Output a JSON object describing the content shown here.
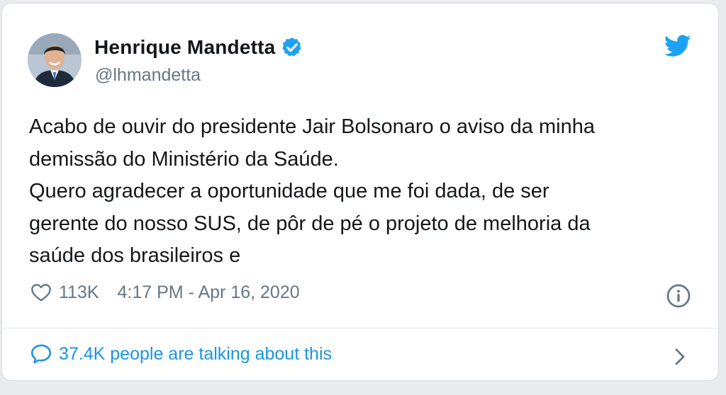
{
  "tweet": {
    "author": {
      "name": "Henrique Mandetta",
      "handle": "@lhmandetta",
      "verified": true
    },
    "text_lines": [
      "Acabo de ouvir do presidente Jair Bolsonaro o aviso da minha",
      "demissão do Ministério da Saúde.",
      "Quero agradecer a oportunidade que me foi dada, de ser",
      "gerente do nosso SUS, de pôr de pé o projeto de melhoria da",
      "saúde dos brasileiros e"
    ],
    "likes": "113K",
    "timestamp": "4:17 PM - Apr 16, 2020",
    "footer_text": "37.4K people are talking about this"
  },
  "icons": {
    "brand": "twitter-bird-icon",
    "verified": "verified-badge-icon",
    "like": "heart-icon",
    "info": "info-icon",
    "reply": "speech-bubble-icon",
    "more": "chevron-right-icon"
  },
  "colors": {
    "twitter_blue": "#1da1f2",
    "link_blue": "#1b95e0",
    "secondary_text": "#657786",
    "primary_text": "#14171a"
  }
}
